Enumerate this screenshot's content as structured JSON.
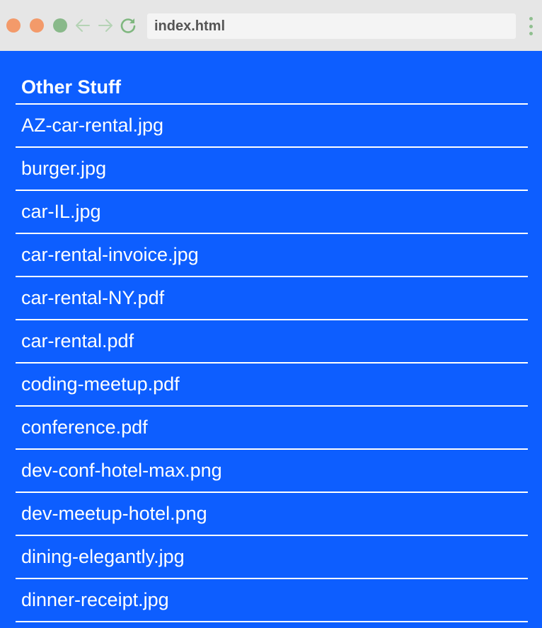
{
  "browser": {
    "url": "index.html",
    "icons": [
      "close-dot",
      "minimize-dot",
      "maximize-dot",
      "back-arrow-icon",
      "forward-arrow-icon",
      "reload-icon",
      "menu-kebab-icon"
    ],
    "colors": {
      "chrome_bg": "#e6e6e6",
      "close": "#f39a6a",
      "minimize": "#f39a6a",
      "maximize": "#89b98a",
      "accent_green": "#8fbf8f"
    }
  },
  "page": {
    "background": "#0d5eff",
    "text_color": "#ffffff",
    "section_title": "Other Stuff",
    "files": [
      "AZ-car-rental.jpg",
      "burger.jpg",
      "car-IL.jpg",
      "car-rental-invoice.jpg",
      "car-rental-NY.pdf",
      "car-rental.pdf",
      "coding-meetup.pdf",
      "conference.pdf",
      "dev-conf-hotel-max.png",
      "dev-meetup-hotel.png",
      "dining-elegantly.jpg",
      "dinner-receipt.jpg"
    ]
  }
}
